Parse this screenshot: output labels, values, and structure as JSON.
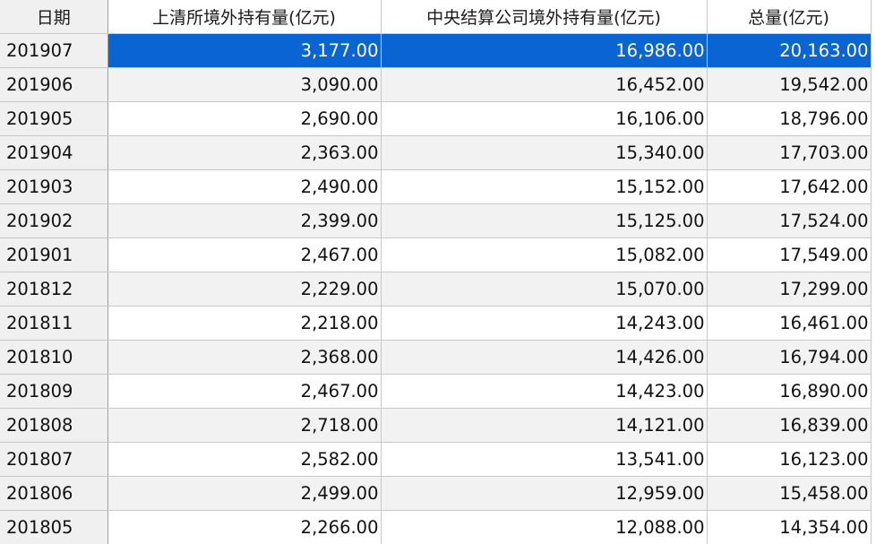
{
  "table": {
    "columns": [
      "日期",
      "上清所境外持有量(亿元)",
      "中央结算公司境外持有量(亿元)",
      "总量(亿元)"
    ],
    "selected_row": 0,
    "colors": {
      "selection": "#0a64d2",
      "header_bg": "#f0f0f0",
      "alt_row_bg": "#f2f2f2",
      "grid_line": "#c8c8c8"
    },
    "rows": [
      {
        "date": "201907",
        "shclearing": "3,177.00",
        "ccdc": "16,986.00",
        "total": "20,163.00"
      },
      {
        "date": "201906",
        "shclearing": "3,090.00",
        "ccdc": "16,452.00",
        "total": "19,542.00"
      },
      {
        "date": "201905",
        "shclearing": "2,690.00",
        "ccdc": "16,106.00",
        "total": "18,796.00"
      },
      {
        "date": "201904",
        "shclearing": "2,363.00",
        "ccdc": "15,340.00",
        "total": "17,703.00"
      },
      {
        "date": "201903",
        "shclearing": "2,490.00",
        "ccdc": "15,152.00",
        "total": "17,642.00"
      },
      {
        "date": "201902",
        "shclearing": "2,399.00",
        "ccdc": "15,125.00",
        "total": "17,524.00"
      },
      {
        "date": "201901",
        "shclearing": "2,467.00",
        "ccdc": "15,082.00",
        "total": "17,549.00"
      },
      {
        "date": "201812",
        "shclearing": "2,229.00",
        "ccdc": "15,070.00",
        "total": "17,299.00"
      },
      {
        "date": "201811",
        "shclearing": "2,218.00",
        "ccdc": "14,243.00",
        "total": "16,461.00"
      },
      {
        "date": "201810",
        "shclearing": "2,368.00",
        "ccdc": "14,426.00",
        "total": "16,794.00"
      },
      {
        "date": "201809",
        "shclearing": "2,467.00",
        "ccdc": "14,423.00",
        "total": "16,890.00"
      },
      {
        "date": "201808",
        "shclearing": "2,718.00",
        "ccdc": "14,121.00",
        "total": "16,839.00"
      },
      {
        "date": "201807",
        "shclearing": "2,582.00",
        "ccdc": "13,541.00",
        "total": "16,123.00"
      },
      {
        "date": "201806",
        "shclearing": "2,499.00",
        "ccdc": "12,959.00",
        "total": "15,458.00"
      },
      {
        "date": "201805",
        "shclearing": "2,266.00",
        "ccdc": "12,088.00",
        "total": "14,354.00"
      }
    ]
  }
}
